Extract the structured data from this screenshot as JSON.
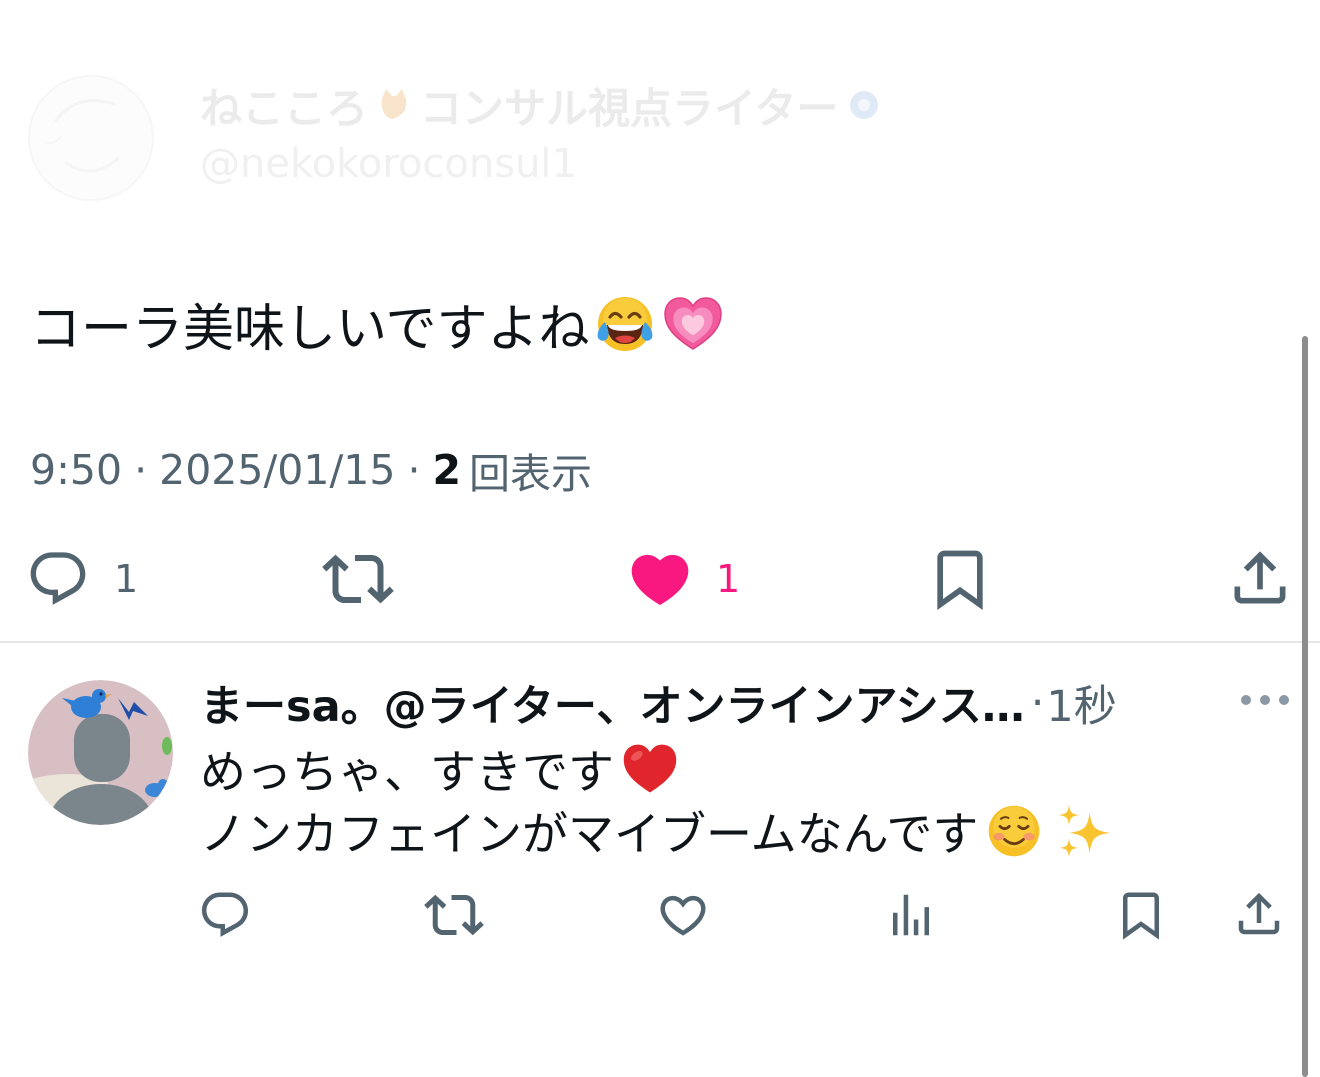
{
  "colors": {
    "text": "#0f1419",
    "secondary": "#536471",
    "like": "#f91880",
    "divider": "#e6e6e6",
    "background": "#ffffff"
  },
  "post": {
    "author": {
      "name_part1": "ねこころ",
      "name_emoji_icon": "cat-emoji",
      "name_part2": "コンサル視点ライター",
      "badge_icon": "badge-icon",
      "handle": "@nekokoroconsul1",
      "avatar_icon": "author-avatar"
    },
    "text": "コーラ美味しいですよね",
    "text_emoji_icons": [
      "face-with-tears-of-joy-emoji",
      "growing-heart-emoji"
    ],
    "time": "9:50",
    "separator": "·",
    "date": "2025/01/15",
    "views_count": "2",
    "views_label": "回表示",
    "actions": {
      "reply": {
        "icon": "reply-icon",
        "count": "1"
      },
      "repost": {
        "icon": "repost-icon"
      },
      "like": {
        "icon": "heart-filled-icon",
        "count": "1",
        "liked": true
      },
      "bookmark": {
        "icon": "bookmark-icon"
      },
      "share": {
        "icon": "share-icon"
      }
    }
  },
  "reply": {
    "author_name": "まーsa。@ライター、オンラインアシス…",
    "separator": "·",
    "time": "1秒",
    "more_icon": "more-dots-icon",
    "avatar_icon": "reply-avatar",
    "lines": [
      {
        "text": "めっちゃ、すきです",
        "emoji_icons": [
          "red-heart-emoji"
        ]
      },
      {
        "text": "ノンカフェインがマイブームなんです",
        "emoji_icons": [
          "smiling-face-emoji",
          "sparkles-emoji"
        ]
      }
    ],
    "actions": [
      "reply-icon",
      "repost-icon",
      "heart-outline-icon",
      "views-icon",
      "bookmark-icon",
      "share-icon"
    ]
  }
}
